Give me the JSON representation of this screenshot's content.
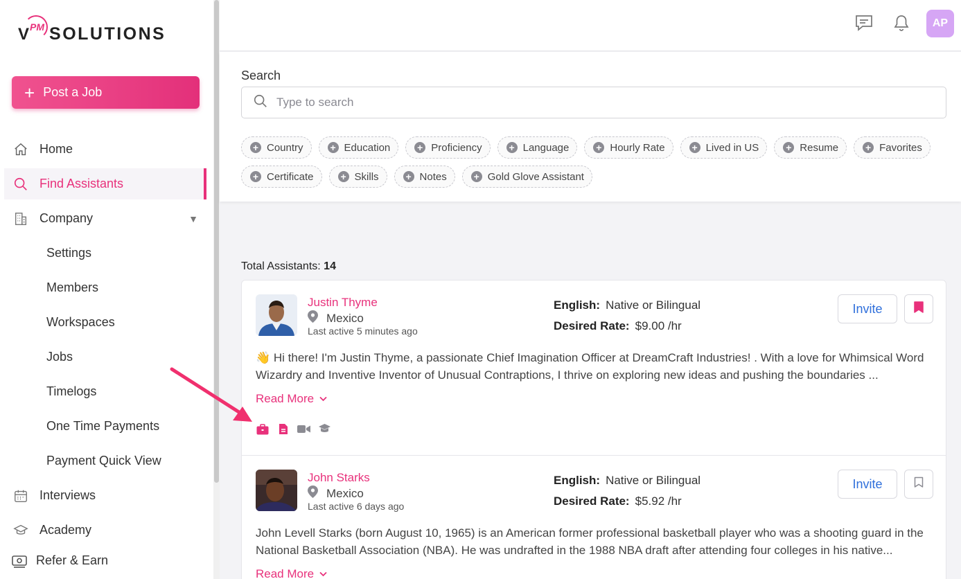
{
  "brand": {
    "logo_v": "V",
    "logo_pm": "PM",
    "logo_text": "SOLUTIONS",
    "accent": "#e8317b"
  },
  "sidebar": {
    "post_job_label": "Post a Job",
    "items": [
      {
        "label": "Home",
        "icon": "home-icon"
      },
      {
        "label": "Find Assistants",
        "icon": "search-icon",
        "active": true
      },
      {
        "label": "Company",
        "icon": "building-icon",
        "expanded": true
      },
      {
        "label": "Interviews",
        "icon": "calendar-icon"
      },
      {
        "label": "Academy",
        "icon": "graduation-cap-icon"
      },
      {
        "label": "Refer & Earn",
        "icon": "money-icon"
      }
    ],
    "company_sub": [
      "Settings",
      "Members",
      "Workspaces",
      "Jobs",
      "Timelogs",
      "One Time Payments",
      "Payment Quick View"
    ]
  },
  "topbar": {
    "avatar_initials": "AP"
  },
  "search": {
    "label": "Search",
    "placeholder": "Type to search",
    "filters_row1": [
      "Country",
      "Education",
      "Proficiency",
      "Language",
      "Hourly Rate",
      "Lived in US",
      "Resume",
      "Favorites"
    ],
    "filters_row2": [
      "Certificate",
      "Skills",
      "Notes",
      "Gold Glove Assistant"
    ]
  },
  "results": {
    "total_label": "Total Assistants:",
    "total_count": "14",
    "assistants": [
      {
        "name": "Justin Thyme",
        "location": "Mexico",
        "last_active": "Last active 5 minutes ago",
        "english_label": "English:",
        "english": "Native or Bilingual",
        "rate_label": "Desired Rate:",
        "rate": "$9.00 /hr",
        "invite_label": "Invite",
        "bookmarked": true,
        "bio": "👋 Hi there! I'm Justin Thyme, a passionate Chief Imagination Officer at DreamCraft Industries! . With a love for Whimsical Word Wizardry and Inventive Inventor of Unusual Contraptions, I thrive on exploring new ideas and pushing the boundaries ...",
        "read_more": "Read More",
        "badges": [
          "briefcase-icon",
          "document-icon",
          "video-icon",
          "graduation-cap-icon"
        ]
      },
      {
        "name": "John Starks",
        "location": "Mexico",
        "last_active": "Last active 6 days ago",
        "english_label": "English:",
        "english": "Native or Bilingual",
        "rate_label": "Desired Rate:",
        "rate": "$5.92 /hr",
        "invite_label": "Invite",
        "bookmarked": false,
        "bio": "John Levell Starks (born August 10, 1965) is an American former professional basketball player who was a shooting guard in the National Basketball Association (NBA). He was undrafted in the 1988 NBA draft after attending four colleges in his native...",
        "read_more": "Read More"
      }
    ]
  }
}
